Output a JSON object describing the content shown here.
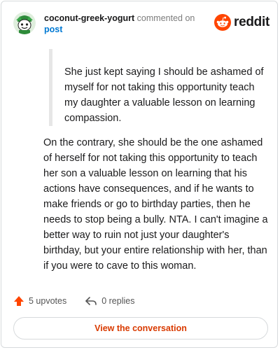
{
  "header": {
    "username": "coconut-greek-yogurt",
    "action_text": "commented on",
    "post_link": "post",
    "brand": "reddit"
  },
  "quote": {
    "text": "She just kept saying I should be ashamed of myself for not taking this opportunity teach my daughter a valuable lesson on learning compassion."
  },
  "comment": {
    "text": "On the contrary, she should be the one ashamed of herself for not taking this opportunity to teach her son a valuable lesson on learning that his actions have consequences, and if he wants to make friends or go to birthday parties, then he needs to stop being a bully. NTA. I can't imagine a better way to ruin not just your daughter's birthday, but your entire relationship with her, than if you were to cave to this woman."
  },
  "actions": {
    "upvotes": "5 upvotes",
    "replies": "0 replies"
  },
  "cta": {
    "label": "View the conversation"
  },
  "colors": {
    "accent": "#d93a00",
    "link": "#0079d3",
    "reddit_orange": "#ff4500",
    "upvote": "#ff4500"
  },
  "icons": {
    "avatar": "snoo-avatar-icon",
    "logo": "reddit-logo-icon",
    "upvote": "upvote-arrow-icon",
    "reply": "reply-arrow-icon"
  }
}
